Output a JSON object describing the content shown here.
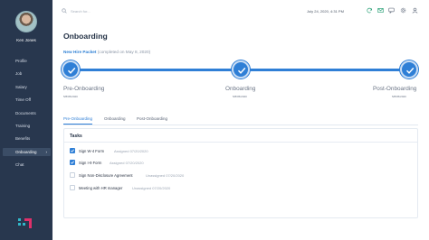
{
  "user": {
    "name": "Ken Jones"
  },
  "sidebar": {
    "items": [
      {
        "label": "Profile"
      },
      {
        "label": "Job"
      },
      {
        "label": "Salary"
      },
      {
        "label": "Time Off"
      },
      {
        "label": "Documents"
      },
      {
        "label": "Training"
      },
      {
        "label": "Benefits"
      },
      {
        "label": "Onboarding",
        "active": true
      },
      {
        "label": "Chat"
      }
    ],
    "active_chevron": "›"
  },
  "header": {
    "search_placeholder": "Search for...",
    "datetime": "July 24, 2020, 4:31 PM",
    "icons": [
      "refresh-icon",
      "mail-icon",
      "message-icon",
      "settings-icon",
      "user-profile-icon"
    ]
  },
  "main": {
    "title": "Onboarding",
    "packet_name": "New Hire Packet",
    "packet_completed": "(completed on May 8, 2020)",
    "steps": [
      {
        "label": "Pre-Onboarding",
        "date": "5/8/05/2020"
      },
      {
        "label": "Onboarding",
        "date": "5/8/05/2020"
      },
      {
        "label": "Post-Onboarding",
        "date": "5/8/05/2020"
      }
    ],
    "tabs": [
      {
        "label": "Pre-Onboarding",
        "active": true
      },
      {
        "label": "Onboarding"
      },
      {
        "label": "Post-Onboarding"
      }
    ],
    "tasks_title": "Tasks",
    "tasks": [
      {
        "name": "Sign W-4 Form",
        "status": "Assigned 07/20/2020",
        "checked": true
      },
      {
        "name": "Sign I-9 Form",
        "status": "Assigned 07/20/2020",
        "checked": true
      },
      {
        "name": "Sign Non-Disclosure Agreement",
        "status": "Unassigned 07/20/2020",
        "checked": false
      },
      {
        "name": "Meeting with HR manager",
        "status": "Unassigned 07/20/2020",
        "checked": false
      }
    ]
  },
  "colors": {
    "sidebar": "#28374e",
    "accent": "#2f7fd6",
    "page_bg": "#eaf2fb"
  }
}
